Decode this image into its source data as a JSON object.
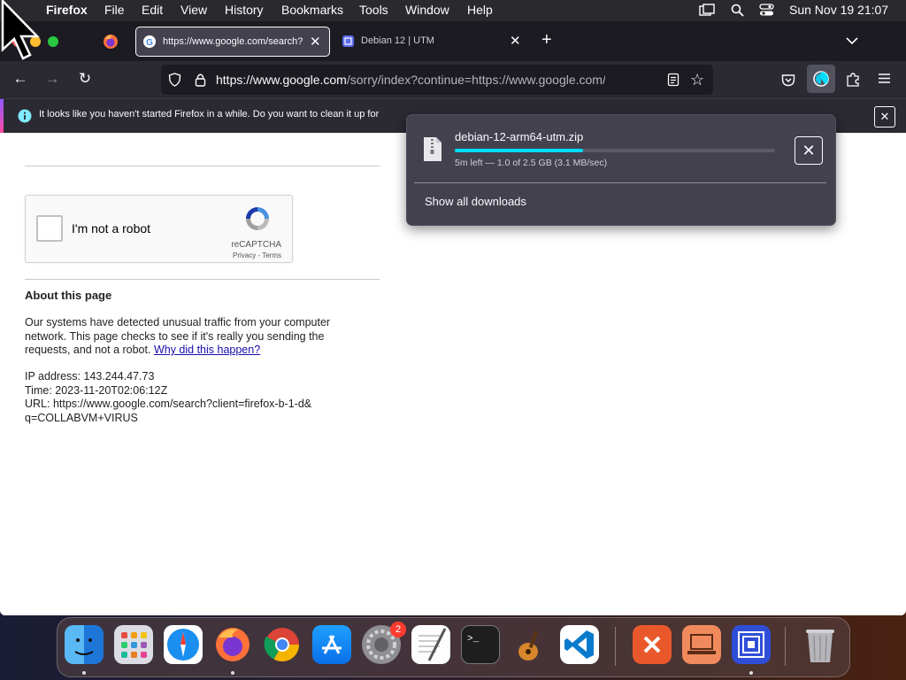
{
  "menubar": {
    "app_name": "Firefox",
    "items": [
      "File",
      "Edit",
      "View",
      "History",
      "Bookmarks",
      "Tools",
      "Window",
      "Help"
    ],
    "clock": "Sun Nov 19  21:07"
  },
  "tabs": [
    {
      "label": "https://www.google.com/search?",
      "icon": "google-icon",
      "active": true
    },
    {
      "label": "Debian 12 | UTM",
      "icon": "utm-icon",
      "active": false
    }
  ],
  "toolbar": {
    "url_domain": "https://www.google.com",
    "url_path": "/sorry/index?continue=https://www.google.com/search"
  },
  "notification": {
    "text": "It looks like you haven't started Firefox in a while. Do you want to clean it up for"
  },
  "downloads": {
    "filename": "debian-12-arm64-utm.zip",
    "status": "5m left — 1.0 of 2.5 GB (3.1 MB/sec)",
    "progress": 0.4,
    "show_all": "Show all downloads"
  },
  "captcha": {
    "label": "I'm not a robot",
    "brand": "reCAPTCHA",
    "links": "Privacy - Terms"
  },
  "page": {
    "about_heading": "About this page",
    "paragraph_text": "Our systems have detected unusual traffic from your computer network. This page checks to see if it's really you sending the requests, and not a robot.",
    "paragraph_link": "Why did this happen?",
    "ip_line": "IP address: 143.244.47.73",
    "time_line": "Time: 2023-11-20T02:06:12Z",
    "url_line": "URL: https://www.google.com/search?client=firefox-b-1-d&q=COLLABVM+VIRUS"
  },
  "dock": {
    "apps": [
      "finder",
      "launchpad",
      "safari",
      "firefox",
      "chrome",
      "app-store",
      "system-settings",
      "textedit",
      "terminal",
      "garageband",
      "vscode",
      "remote-desktop",
      "vm-app",
      "utm",
      "trash"
    ],
    "settings_badge": "2"
  },
  "colors": {
    "accent": "#00ddff",
    "toolbar_bg": "#2b2a33",
    "link": "#1a0dab"
  }
}
